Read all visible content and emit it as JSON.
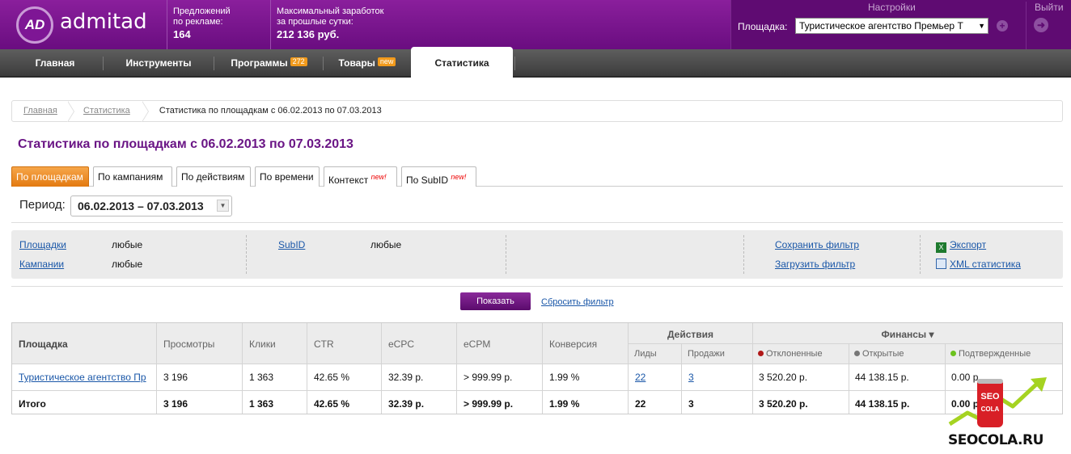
{
  "header": {
    "logo_text": "AD",
    "brand": "admitad",
    "offers_label1": "Предложений",
    "offers_label2": "по рекламе:",
    "offers_value": "164",
    "earn_label1": "Максимальный заработок",
    "earn_label2": "за прошлые сутки:",
    "earn_value": "212 136 руб.",
    "settings": "Настройки",
    "logout": "Выйти",
    "platform_label": "Площадка:",
    "platform_value": "Туристическое агентство Премьер Т"
  },
  "nav": {
    "items": [
      "Главная",
      "Инструменты",
      "Программы",
      "Товары",
      "Статистика"
    ],
    "programs_badge": "272",
    "goods_badge": "new"
  },
  "breadcrumb": [
    "Главная",
    "Статистика",
    "Статистика по площадкам с 06.02.2013 по 07.03.2013"
  ],
  "page_title": "Статистика по площадкам с 06.02.2013 по 07.03.2013",
  "tabs": [
    "По площадкам",
    "По кампаниям",
    "По действиям",
    "По времени",
    "Контекст",
    "По SubID"
  ],
  "tab_new": "new!",
  "period": {
    "label": "Период:",
    "value": "06.02.2013  –  07.03.2013"
  },
  "filter": {
    "platforms": "Площадки",
    "platforms_val": "любые",
    "campaigns": "Кампании",
    "campaigns_val": "любые",
    "subid": "SubID",
    "subid_val": "любые",
    "save": "Сохранить фильтр",
    "load": "Загрузить фильтр",
    "export": "Экспорт",
    "xml": "XML статистика"
  },
  "show_button": "Показать",
  "reset_filter": "Сбросить фильтр",
  "table": {
    "headers": {
      "platform": "Площадка",
      "views": "Просмотры",
      "clicks": "Клики",
      "ctr": "CTR",
      "ecpc": "eCPC",
      "ecpm": "eCPM",
      "conv": "Конверсия",
      "actions": "Действия",
      "leads": "Лиды",
      "sales": "Продажи",
      "finance": "Финансы ▾",
      "declined": "Отклоненные",
      "open": "Открытые",
      "confirmed": "Подтвержденные"
    },
    "row": {
      "platform": "Туристическое агентство Пр",
      "views": "3 196",
      "clicks": "1 363",
      "ctr": "42.65 %",
      "ecpc": "32.39 р.",
      "ecpm": "> 999.99 р.",
      "conv": "1.99 %",
      "leads": "22",
      "sales": "3",
      "declined": "3 520.20 р.",
      "open": "44 138.15 р.",
      "confirmed": "0.00 р."
    },
    "total": {
      "platform": "Итого",
      "views": "3 196",
      "clicks": "1 363",
      "ctr": "42.65 %",
      "ecpc": "32.39 р.",
      "ecpm": "> 999.99 р.",
      "conv": "1.99 %",
      "leads": "22",
      "sales": "3",
      "declined": "3 520.20 р.",
      "open": "44 138.15 р.",
      "confirmed": "0.00 р."
    }
  },
  "colors": {
    "purple": "#6a1585",
    "declined_dot": "#b01818",
    "open_dot": "#777777",
    "confirmed_dot": "#6cc21e"
  },
  "watermark": {
    "can_text1": "SEO",
    "can_text2": "COLA",
    "site": "SEOCOLA.RU"
  }
}
